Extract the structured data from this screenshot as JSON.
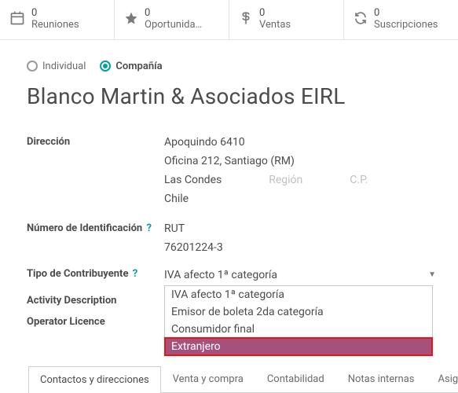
{
  "stats": {
    "meetings": {
      "count": "0",
      "label": "Reuniones"
    },
    "opportunities": {
      "count": "0",
      "label": "Oportunida…"
    },
    "sales": {
      "count": "0",
      "label": "Ventas"
    },
    "subscriptions": {
      "count": "0",
      "label": "Suscripciones"
    }
  },
  "type_selector": {
    "individual": "Individual",
    "company": "Compañía",
    "selected": "company"
  },
  "company_name": "Blanco Martin & Asociados EIRL",
  "labels": {
    "address": "Dirección",
    "id_number": "Número de Identificación",
    "taxpayer_type": "Tipo de Contribuyente",
    "activity_desc": "Activity Description",
    "operator_lic": "Operator Licence",
    "help": "?"
  },
  "address": {
    "street": "Apoquindo 6410",
    "street2": "Oficina 212, Santiago (RM)",
    "city": "Las Condes",
    "region_placeholder": "Región",
    "zip_placeholder": "C.P.",
    "country": "Chile"
  },
  "identification": {
    "type": "RUT",
    "value": "76201224-3"
  },
  "taxpayer": {
    "selected": "IVA afecto 1ª categoría",
    "options": [
      "IVA afecto 1ª categoría",
      "Emisor de boleta 2da categoría",
      "Consumidor final",
      "Extranjero"
    ],
    "highlighted_index": 3
  },
  "tabs": [
    "Contactos y direcciones",
    "Venta y compra",
    "Contabilidad",
    "Notas internas",
    "Asignar"
  ],
  "active_tab_index": 0
}
